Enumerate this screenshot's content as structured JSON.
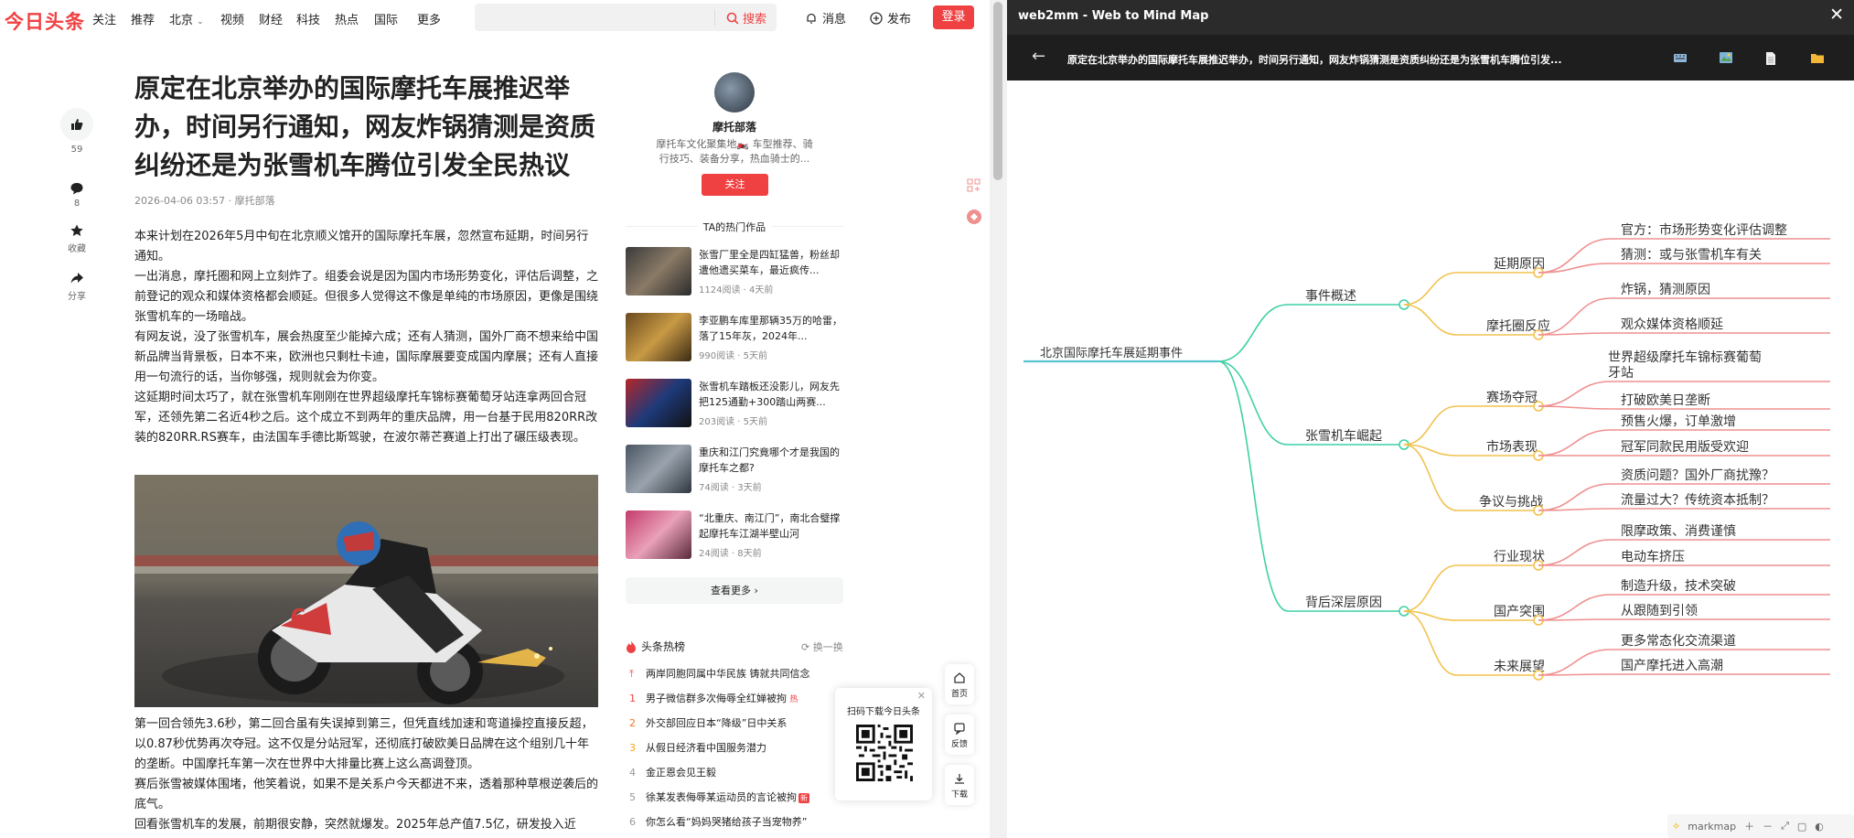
{
  "nav": {
    "logo": "今日头条",
    "items": [
      "关注",
      "推荐",
      "北京",
      "视频",
      "财经",
      "科技",
      "热点",
      "国际",
      "更多"
    ],
    "search_label": "搜索",
    "message": "消息",
    "publish": "发布",
    "login": "登录"
  },
  "side_actions": {
    "like_count": "59",
    "comment_count": "8",
    "favorite": "收藏",
    "share": "分享"
  },
  "article": {
    "title": "原定在北京举办的国际摩托车展推迟举办，时间另行通知，网友炸锅猜测是资质纠纷还是为张雪机车腾位引发全民热议",
    "meta": "2026-04-06 03:57 · 摩托部落",
    "paragraphs": [
      "本来计划在2026年5月中旬在北京顺义馆开的国际摩托车展，忽然宣布延期，时间另行通知。",
      "一出消息，摩托圈和网上立刻炸了。组委会说是因为国内市场形势变化，评估后调整，之前登记的观众和媒体资格都会顺延。但很多人觉得这不像是单纯的市场原因，更像是围绕张雪机车的一场暗战。",
      "有网友说，没了张雪机车，展会热度至少能掉六成；还有人猜测，国外厂商不想来给中国新品牌当背景板，日本不来，欧洲也只剩杜卡迪，国际摩展要变成国内摩展；还有人直接用一句流行的话，当你够强，规则就会为你变。",
      "这延期时间太巧了，就在张雪机车刚刚在世界超级摩托车锦标赛葡萄牙站连拿两回合冠军，还领先第二名近4秒之后。这个成立不到两年的重庆品牌，用一台基于民用820RR改装的820RR.RS赛车，由法国车手德比斯驾驶，在波尔蒂芒赛道上打出了碾压级表现。"
    ],
    "paragraphs2": [
      "第一回合领先3.6秒，第二回合虽有失误掉到第三，但凭直线加速和弯道操控直接反超，以0.87秒优势再次夺冠。这不仅是分站冠军，还彻底打破欧美日品牌在这个组别几十年的垄断。中国摩托车第一次在世界中大排量比赛上这么高调登顶。",
      "赛后张雪被媒体围堵，他笑着说，如果不是关系户今天都进不来，透着那种草根逆袭后的底气。",
      "回看张雪机车的发展，前期很安静，突然就爆发。2025年总产值7.5亿，研发投入近"
    ]
  },
  "author": {
    "name": "摩托部落",
    "desc": "摩托车文化聚集地🏍️ 车型推荐、骑行技巧、装备分享，热血骑士的...",
    "follow": "关注",
    "works_heading": "TA的热门作品",
    "works": [
      {
        "title": "张雪厂里全是四缸猛兽，粉丝却遭他遗买菜车，最近疯传...",
        "meta": "1124阅读 · 4天前"
      },
      {
        "title": "李亚鹏车库里那辆35万的哈雷，落了15年灰，2024年...",
        "meta": "990阅读 · 5天前"
      },
      {
        "title": "张雪机车踏板还没影儿，网友先把125通勤+300踏山两赛...",
        "meta": "203阅读 · 5天前"
      },
      {
        "title": "重庆和江门究竟哪个才是我国的摩托车之都?",
        "meta": "74阅读 · 3天前"
      },
      {
        "title": "“北重庆、南江门”，南北合璧撑起摩托车江湖半壁山河",
        "meta": "24阅读 · 8天前"
      }
    ],
    "more_works": "查看更多"
  },
  "hotlist": {
    "heading": "头条热榜",
    "refresh": "换一换",
    "items": [
      {
        "num": "",
        "text": "两岸同胞同属中华民族 铸就共同信念"
      },
      {
        "num": "1",
        "text": "男子微信群多次侮辱全红婵被拘"
      },
      {
        "num": "2",
        "text": "外交部回应日本“降级”日中关系"
      },
      {
        "num": "3",
        "text": "从假日经济看中国服务潜力"
      },
      {
        "num": "4",
        "text": "金正恩会见王毅"
      },
      {
        "num": "5",
        "text": "徐某发表侮辱某运动员的言论被拘"
      },
      {
        "num": "6",
        "text": "你怎么看“妈妈哭猪给孩子当宠物养”"
      }
    ],
    "new_tag": "新"
  },
  "qr": {
    "text": "扫码下载今日头条"
  },
  "float": {
    "home": "首页",
    "feedback": "反馈",
    "download": "下载"
  },
  "right": {
    "window_title": "web2mm - Web to Mind Map",
    "page_title": "原定在北京举办的国际摩托车展推迟举办，时间另行通知，网友炸锅猜测是资质纠纷还是为张雪机车腾位引发...",
    "markmap": "markmap",
    "colors": {
      "root": "#57c2d1",
      "l1": "#3fd0a6",
      "l2": "#f2c24f",
      "l3": "#f08f8f"
    },
    "mindmap": {
      "root": "北京国际摩托车展延期事件",
      "branches": [
        {
          "label": "事件概述",
          "children": [
            {
              "label": "延期原因",
              "leaves": [
                "官方：市场形势变化评估调整",
                "猜测：或与张雪机车有关"
              ]
            },
            {
              "label": "摩托圈反应",
              "leaves": [
                "炸锅，猜测原因",
                "观众媒体资格顺延"
              ]
            }
          ]
        },
        {
          "label": "张雪机车崛起",
          "children": [
            {
              "label": "赛场夺冠",
              "leaves": [
                "世界超级摩托车锦标赛葡萄牙站",
                "打破欧美日垄断"
              ]
            },
            {
              "label": "市场表现",
              "leaves": [
                "预售火爆，订单激增",
                "冠军同款民用版受欢迎"
              ]
            },
            {
              "label": "争议与挑战",
              "leaves": [
                "资质问题？国外厂商扰豫？",
                "流量过大？传统资本抵制？"
              ]
            }
          ]
        },
        {
          "label": "背后深层原因",
          "children": [
            {
              "label": "行业现状",
              "leaves": [
                "限摩政策、消费谨慎",
                "电动车挤压"
              ]
            },
            {
              "label": "国产突围",
              "leaves": [
                "制造升级，技术突破",
                "从跟随到引领"
              ]
            },
            {
              "label": "未来展望",
              "leaves": [
                "更多常态化交流渠道",
                "国产摩托进入高潮"
              ]
            }
          ]
        }
      ]
    }
  }
}
